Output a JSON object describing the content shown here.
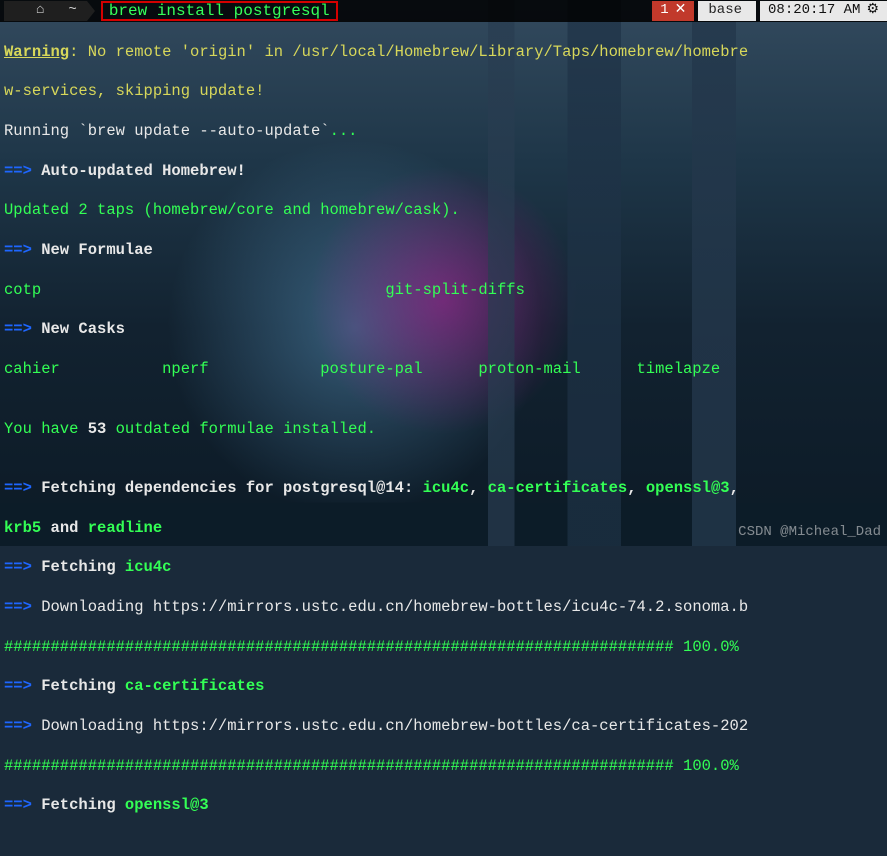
{
  "topbar": {
    "apple_icon": "",
    "home_icon": "⌂",
    "tilde": "~",
    "command": "brew install postgresql",
    "tabs_count": "1",
    "tabs_close": "✕",
    "env_label": "base",
    "env_icon": "",
    "clock": "08:20:17 AM",
    "gear_icon": "⚙"
  },
  "lines": {
    "l1a": "Warning",
    "l1b": ": No remote 'origin' in /usr/local/Homebrew/Library/Taps/homebrew/homebre",
    "l2": "w-services, skipping update!",
    "l3a": "Running `brew update --auto-update`",
    "l3b": "...",
    "l4a": "==>",
    "l4b": " Auto-updated Homebrew!",
    "l5": "Updated 2 taps (homebrew/core and homebrew/cask).",
    "l6a": "==>",
    "l6b": " New Formulae",
    "l7": "cotp                                     git-split-diffs",
    "l8a": "==>",
    "l8b": " New Casks",
    "l9": "cahier           nperf            posture-pal      proton-mail      timelapze",
    "blank": "",
    "l10a": "You have ",
    "l10b": "53",
    "l10c": " outdated formulae",
    "l10d": " installed.",
    "l11a": "==>",
    "l11b": " Fetching dependencies for postgresql@14: ",
    "l11c": "icu4c",
    "l11d": ", ",
    "l11e": "ca-certificates",
    "l11f": ", ",
    "l11g": "openssl@3",
    "l11h": ",",
    "l12a": "krb5",
    "l12b": " and ",
    "l12c": "readline",
    "l13a": "==>",
    "l13b": " Fetching ",
    "l13c": "icu4c",
    "l14a": "==>",
    "l14b": " Downloading https://mirrors.ustc.edu.cn/homebrew-bottles/icu4c-74.2.sonoma.b",
    "l15a": "########################################################################",
    "l15b": " 100.0%",
    "l16a": "==>",
    "l16b": " Fetching ",
    "l16c": "ca-certificates",
    "l17a": "==>",
    "l17b": " Downloading https://mirrors.ustc.edu.cn/homebrew-bottles/ca-certificates-202",
    "l18a": "########################################################################",
    "l18b": " 100.0%",
    "l19a": "==>",
    "l19b": " Fetching ",
    "l19c": "openssl@3"
  },
  "watermark": "CSDN @Micheal_Dad"
}
